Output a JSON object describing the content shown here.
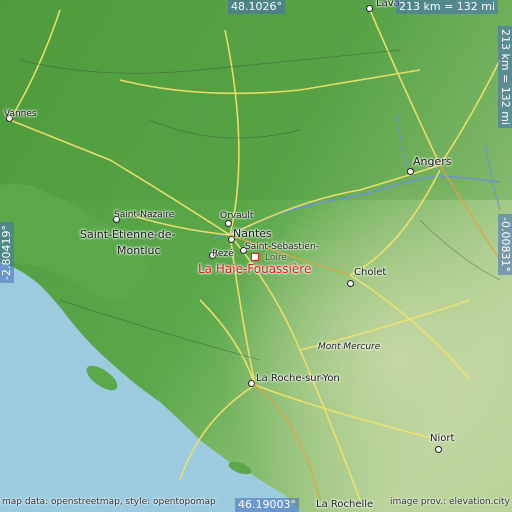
{
  "place": {
    "name": "La Haie-Fouassière",
    "marker_color": "#e01919"
  },
  "coords": {
    "top_lat": "48.1026°",
    "bottom_lat": "46.19003°",
    "left_lon": "-2.80419°",
    "right_lon": "-0.00831°"
  },
  "scale": {
    "top": "213 km = 132 mi",
    "right": "213 km = 132 mi"
  },
  "cities": {
    "laval": "Laval",
    "vannes": "Vannes",
    "angers": "Angers",
    "saint_nazaire": "Saint-Nazaire",
    "saint_etienne_line1": "Saint-Étienne-de-",
    "saint_etienne_line2": "Montluc",
    "orvault": "Orvault",
    "nantes": "Nantes",
    "saint_sebastien_line1": "Saint-Sébastien-",
    "saint_sebastien_line2": "Loire",
    "reze": "Rezé",
    "cholet": "Cholet",
    "mont_mercure": "Mont Mercure",
    "la_roche": "La Roche-sur-Yon",
    "niort": "Niort",
    "la_rochelle": "La Rochelle"
  },
  "credits": {
    "left": "map data: openstreetmap, style: opentopomap",
    "right": "image prov.: elevation.city"
  },
  "colors": {
    "sea": "#9ccbe0",
    "lowland": "#5fae4a",
    "upland": "#a8c98a"
  }
}
